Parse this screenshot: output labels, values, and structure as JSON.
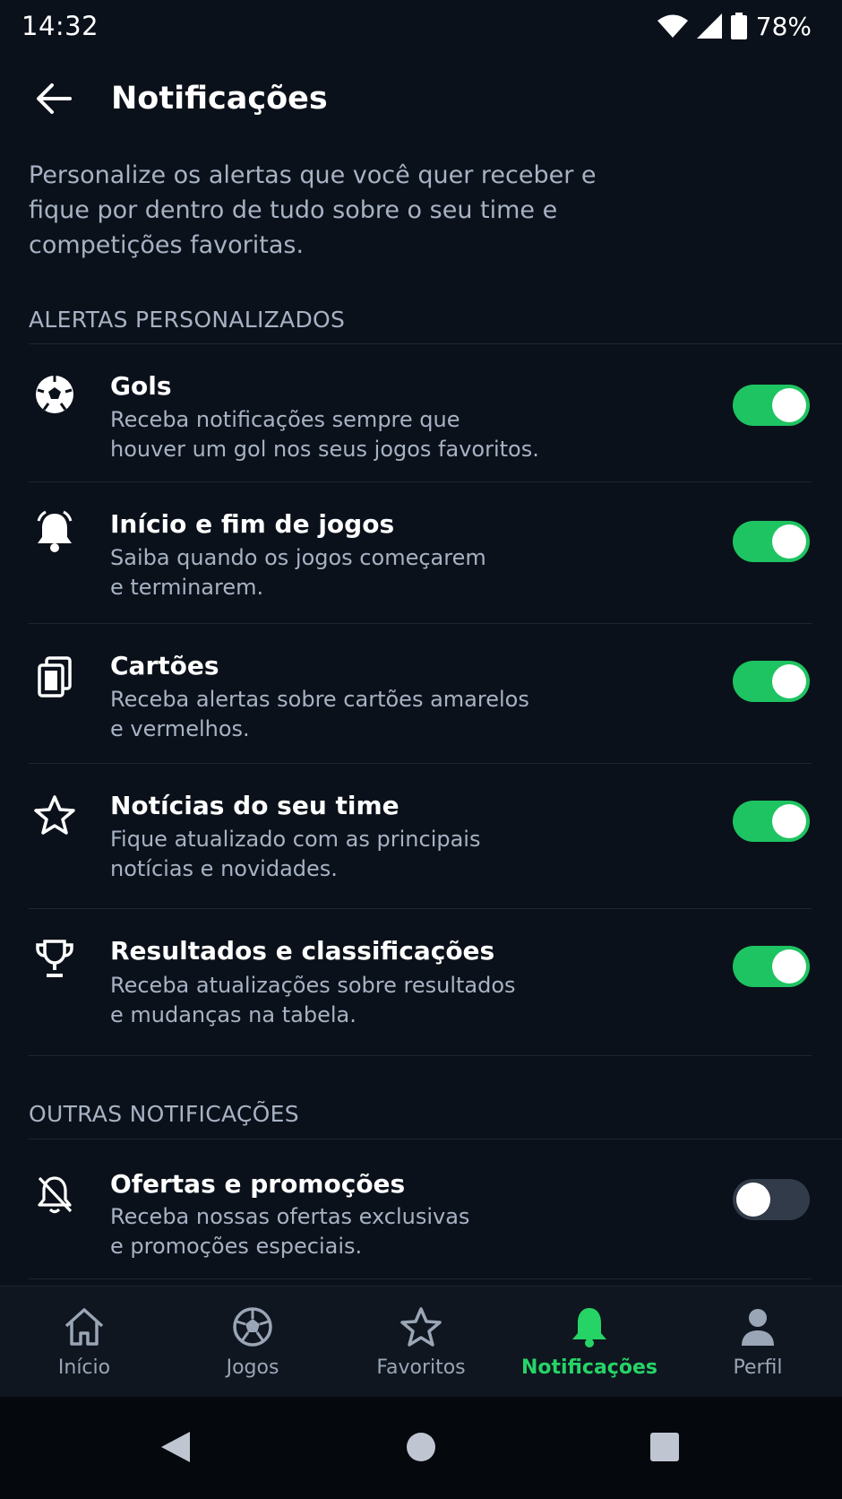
{
  "status_bar": {
    "time": "14:32",
    "battery": "78%"
  },
  "header": {
    "title": "Notificações",
    "back_icon": "arrow-left-icon"
  },
  "intro": "Personalize os alertas que você quer receber e fique por dentro de tudo sobre o seu time e competições favoritas.",
  "sections": [
    {
      "title": "ALERTAS PERSONALIZADOS",
      "items": [
        {
          "icon": "soccer-ball-icon",
          "title": "Gols",
          "desc_line1": "Receba notificações sempre que",
          "desc_line2": "houver um gol nos seus jogos favoritos.",
          "enabled": true
        },
        {
          "icon": "bell-icon",
          "title": "Início e fim de jogos",
          "desc_line1": "Saiba quando os jogos começarem",
          "desc_line2": "e terminarem.",
          "enabled": true
        },
        {
          "icon": "cards-icon",
          "title": "Cartões",
          "desc_line1": "Receba alertas sobre cartões amarelos",
          "desc_line2": "e vermelhos.",
          "enabled": true
        },
        {
          "icon": "star-icon",
          "title": "Notícias do seu time",
          "desc_line1": "Fique atualizado com as principais",
          "desc_line2": "notícias e novidades.",
          "enabled": true
        },
        {
          "icon": "trophy-icon",
          "title": "Resultados e classificações",
          "desc_line1": "Receba atualizações sobre resultados",
          "desc_line2": "e mudanças na tabela.",
          "enabled": true
        }
      ]
    },
    {
      "title": "OUTRAS NOTIFICAÇÕES",
      "items": [
        {
          "icon": "bell-off-icon",
          "title": "Ofertas e promoções",
          "desc_line1": "Receba nossas ofertas exclusivas",
          "desc_line2": "e promoções especiais.",
          "enabled": false
        }
      ]
    }
  ],
  "bottom_nav": [
    {
      "label": "Início",
      "icon": "home-icon",
      "active": false
    },
    {
      "label": "Jogos",
      "icon": "soccer-ball-icon",
      "active": false
    },
    {
      "label": "Favoritos",
      "icon": "star-icon",
      "active": false
    },
    {
      "label": "Notificações",
      "icon": "bell-icon",
      "active": true
    },
    {
      "label": "Perfil",
      "icon": "person-icon",
      "active": false
    }
  ],
  "colors": {
    "background": "#0b111a",
    "accent": "#1ec461",
    "nav_active": "#26d466",
    "muted_text": "#a7b2c4"
  }
}
